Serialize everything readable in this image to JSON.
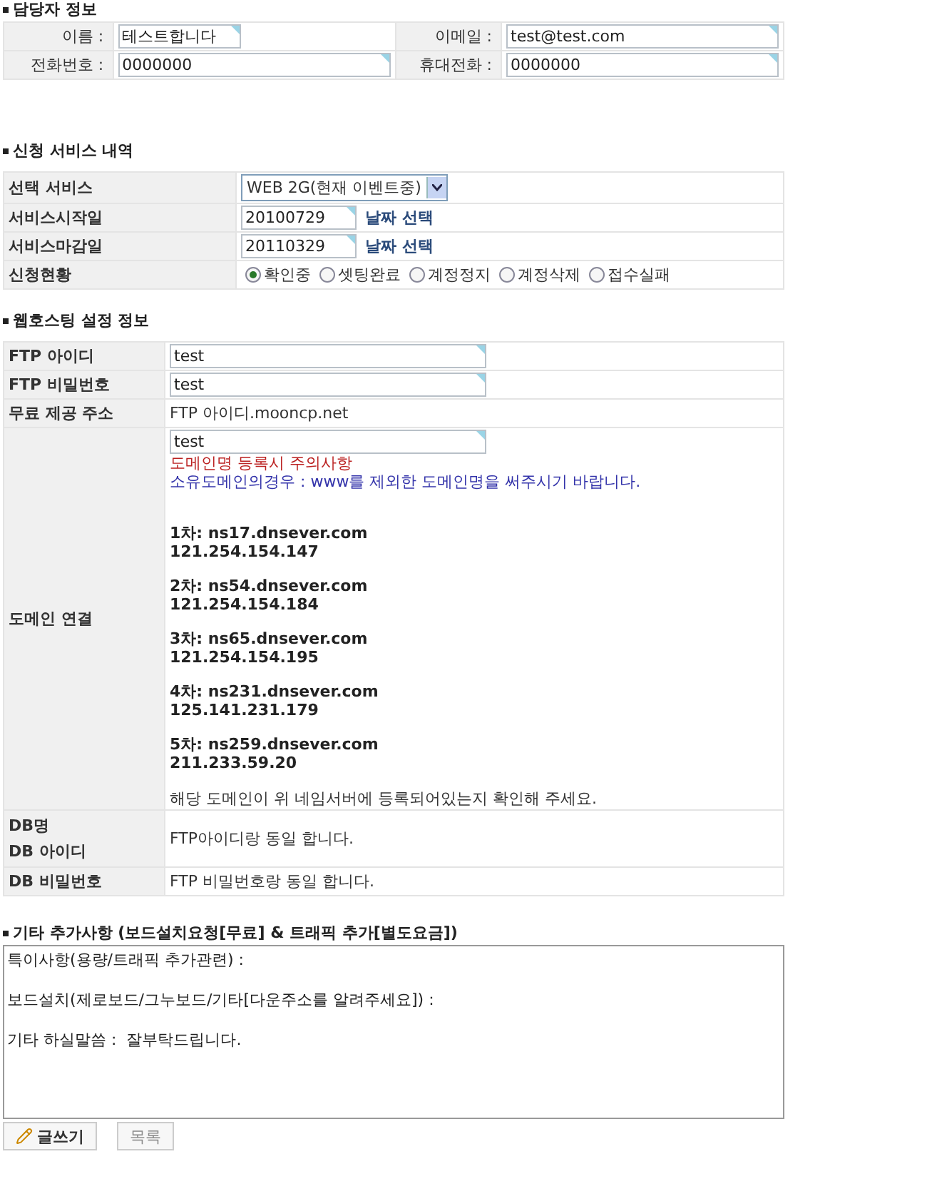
{
  "contact": {
    "title": "담당자 정보",
    "fields": [
      {
        "label": "이름 :",
        "value": "테스트합니다"
      },
      {
        "label": "이메일 :",
        "value": "test@test.com"
      },
      {
        "label": "전화번호 :",
        "value": "0000000"
      },
      {
        "label": "휴대전화 :",
        "value": "0000000"
      }
    ]
  },
  "service": {
    "title": "신청 서비스 내역",
    "select": {
      "label": "선택 서비스",
      "value": "WEB 2G(현재 이벤트중)"
    },
    "dates": [
      {
        "label": "서비스시작일",
        "value": "20100729",
        "link": "날짜 선택"
      },
      {
        "label": "서비스마감일",
        "value": "20110329",
        "link": "날짜 선택"
      }
    ],
    "status": {
      "label": "신청현황",
      "options": [
        {
          "label": "확인중",
          "selected": true
        },
        {
          "label": "셋팅완료",
          "selected": false
        },
        {
          "label": "계정정지",
          "selected": false
        },
        {
          "label": "계정삭제",
          "selected": false
        },
        {
          "label": "접수실패",
          "selected": false
        }
      ]
    }
  },
  "hosting": {
    "title": "웹호스팅 설정 정보",
    "ftp_fields": [
      {
        "label": "FTP 아이디",
        "value": "test"
      },
      {
        "label": "FTP 비밀번호",
        "value": "test"
      }
    ],
    "free_address": {
      "label": "무료 제공 주소",
      "value": "FTP 아이디.mooncp.net"
    },
    "domain": {
      "label": "도메인 연결",
      "value": "test",
      "notice_title": "도메인명 등록시 주의사항",
      "notice_text": "소유도메인의경우 : www를 제외한 도메인명을 써주시기 바랍니다.",
      "nameservers": [
        {
          "name": "1차: ns17.dnsever.com",
          "ip": "121.254.154.147"
        },
        {
          "name": "2차: ns54.dnsever.com",
          "ip": "121.254.154.184"
        },
        {
          "name": "3차: ns65.dnsever.com",
          "ip": "121.254.154.195"
        },
        {
          "name": "4차: ns231.dnsever.com",
          "ip": "125.141.231.179"
        },
        {
          "name": "5차: ns259.dnsever.com",
          "ip": "211.233.59.20"
        }
      ],
      "confirm": "해당 도메인이 위 네임서버에 등록되어있는지 확인해 주세요."
    },
    "db": {
      "labels": [
        "DB명",
        "DB 아이디"
      ],
      "value": "FTP아이디랑 동일 합니다."
    },
    "db_password": {
      "label": "DB 비밀번호",
      "value": "FTP 비밀번호랑 동일 합니다."
    }
  },
  "extra": {
    "title": "기타 추가사항 (보드설치요청[무료] & 트래픽 추가[별도요금])",
    "lines": [
      "특이사항(용량/트래픽 추가관련) :",
      "보드설치(제로보드/그누보드/기타[다운주소를 알려주세요]) :",
      "기타 하실말씀 :  잘부탁드립니다."
    ]
  },
  "buttons": [
    {
      "label": "글쓰기",
      "kind": "write"
    },
    {
      "label": "목록",
      "kind": "list"
    }
  ]
}
